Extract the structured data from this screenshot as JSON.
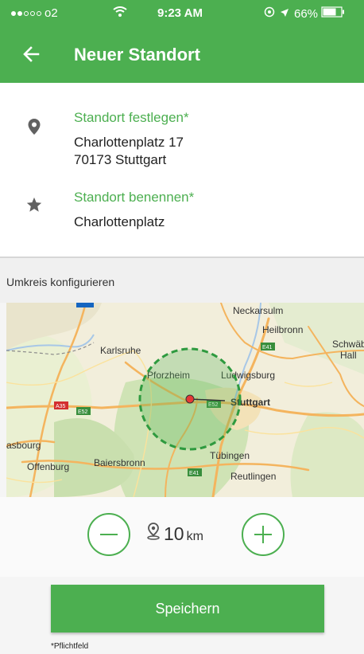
{
  "status_bar": {
    "carrier": "o2",
    "time": "9:23 AM",
    "battery": "66%",
    "icons": [
      "signal-dots",
      "wifi-icon",
      "location-lock-icon",
      "location-arrow-icon",
      "battery-icon"
    ]
  },
  "app_bar": {
    "title": "Neuer Standort",
    "back_icon": "arrow-left-icon"
  },
  "location": {
    "label": "Standort festlegen*",
    "street": "Charlottenplatz 17",
    "city": "70173 Stuttgart",
    "icon": "map-pin-icon"
  },
  "name_field": {
    "label": "Standort benennen*",
    "value": "Charlottenplatz",
    "icon": "star-icon"
  },
  "radius_section": {
    "title": "Umkreis konfigurieren"
  },
  "map": {
    "labels": [
      "Neckarsulm",
      "Heilbronn",
      "Schwäbisc",
      "Hall",
      "Karlsruhe",
      "Pforzheim",
      "Ludwigsburg",
      "Stuttgart",
      "asbourg",
      "Offenburg",
      "Baiersbronn",
      "Tübingen",
      "Reutlingen"
    ],
    "road_labels": [
      "A35",
      "E52",
      "E52",
      "E41",
      "E41"
    ],
    "circle_color": "#4caf50"
  },
  "radius": {
    "value": "10",
    "unit": "km",
    "minus_icon": "minus-circle-icon",
    "plus_icon": "plus-circle-icon",
    "icon": "location-person-icon"
  },
  "save_button": "Speichern",
  "footnote": "*Pflichtfeld",
  "colors": {
    "primary": "#4caf50",
    "marker": "#e53935"
  }
}
